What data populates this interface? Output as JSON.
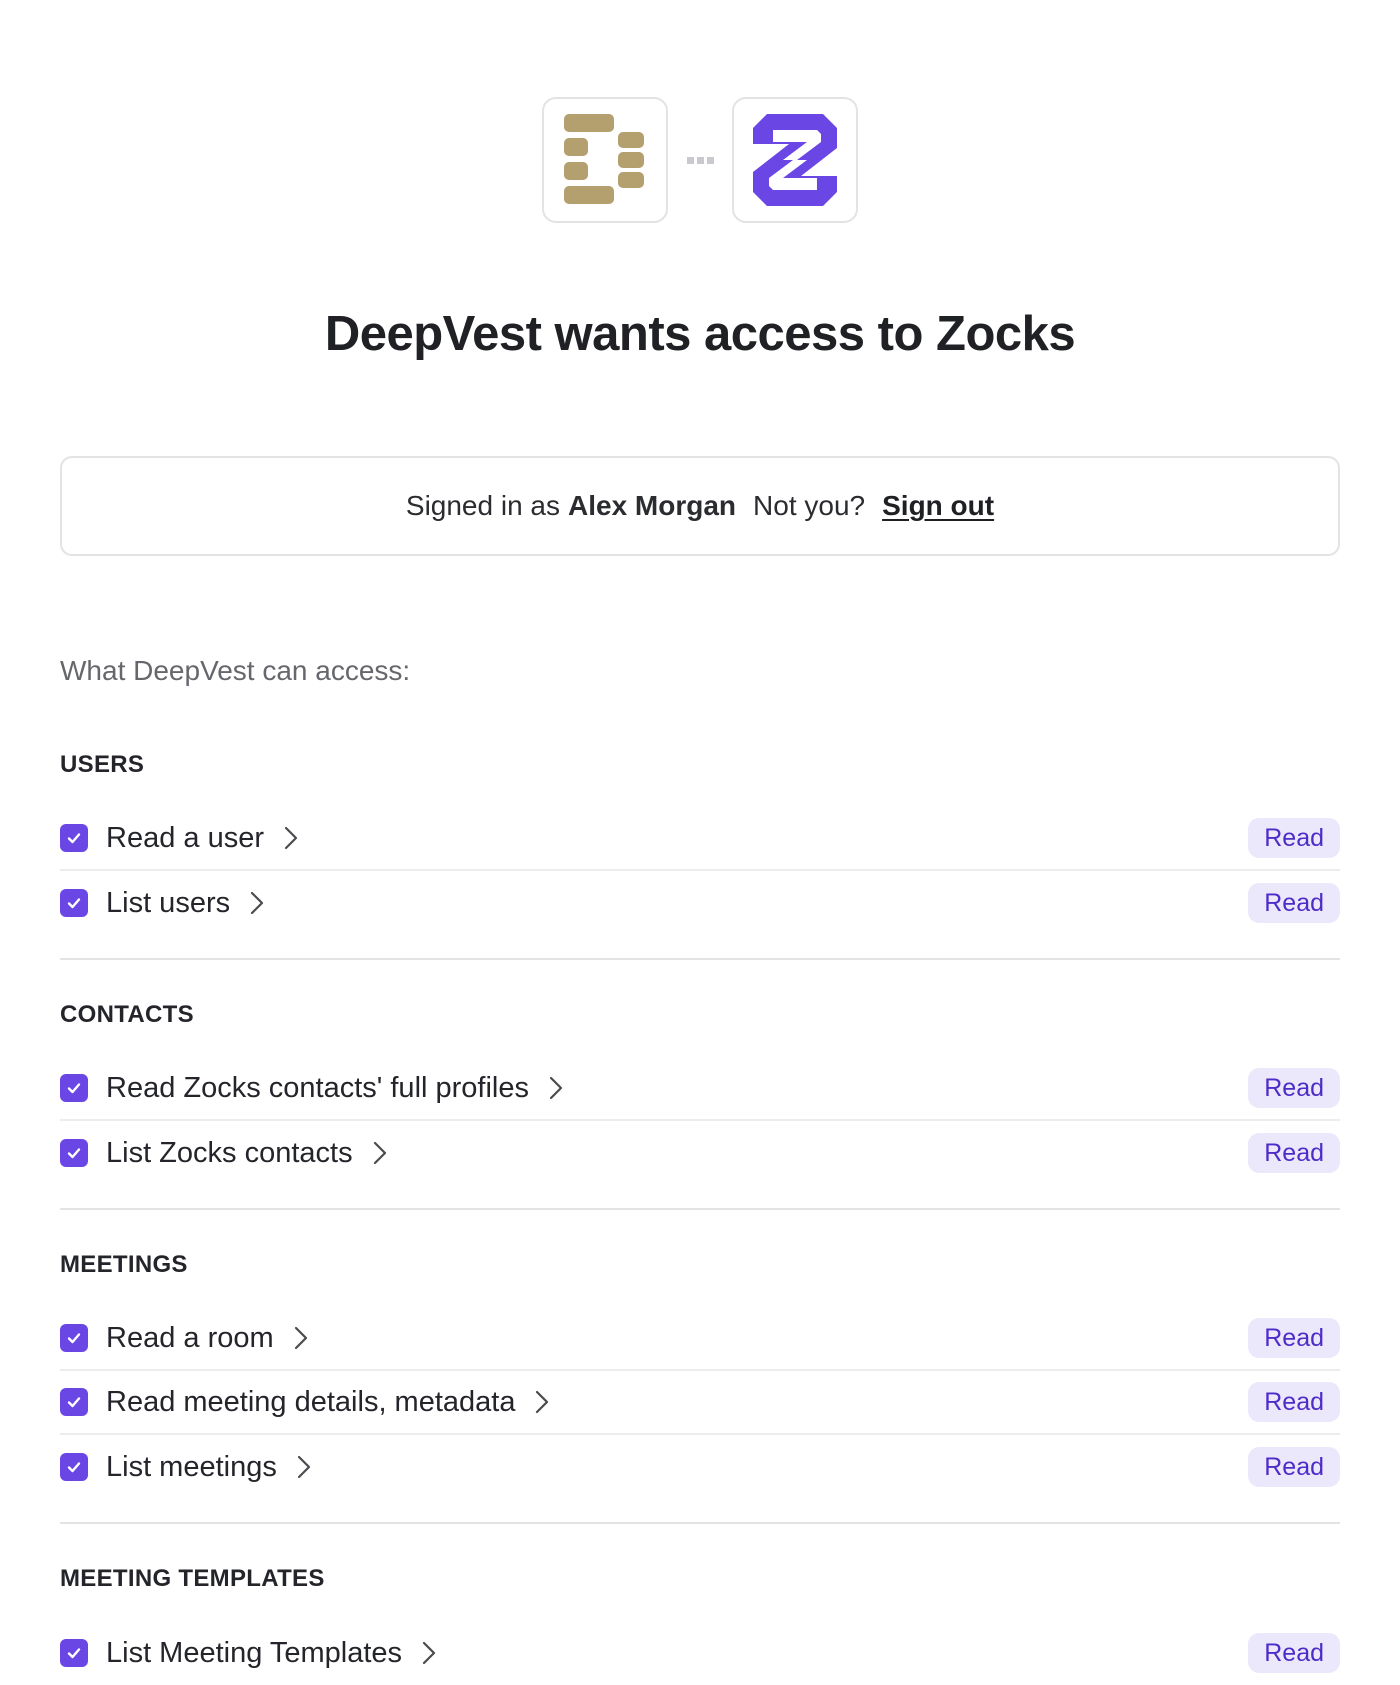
{
  "header": {
    "title": "DeepVest wants access to Zocks",
    "source_logo": "deepvest-logo-icon",
    "target_logo": "zocks-logo-icon",
    "colors": {
      "deepvest_gold": "#b3a06e",
      "zocks_purple": "#6a46e5"
    }
  },
  "signin": {
    "prefix": "Signed in as",
    "user_name": "Alex Morgan",
    "not_you": "Not you?",
    "sign_out": "Sign out"
  },
  "access": {
    "heading": "What DeepVest can access:"
  },
  "sections": [
    {
      "title": "USERS",
      "items": [
        {
          "label": "Read a user",
          "badge": "Read",
          "checked": true
        },
        {
          "label": "List users",
          "badge": "Read",
          "checked": true
        }
      ]
    },
    {
      "title": "CONTACTS",
      "items": [
        {
          "label": "Read Zocks contacts' full profiles",
          "badge": "Read",
          "checked": true
        },
        {
          "label": "List Zocks contacts",
          "badge": "Read",
          "checked": true
        }
      ]
    },
    {
      "title": "MEETINGS",
      "items": [
        {
          "label": "Read a room",
          "badge": "Read",
          "checked": true
        },
        {
          "label": "Read meeting details, metadata",
          "badge": "Read",
          "checked": true
        },
        {
          "label": "List meetings",
          "badge": "Read",
          "checked": true
        }
      ]
    },
    {
      "title": "MEETING TEMPLATES",
      "items": [
        {
          "label": "List Meeting Templates",
          "badge": "Read",
          "checked": true
        }
      ]
    }
  ]
}
